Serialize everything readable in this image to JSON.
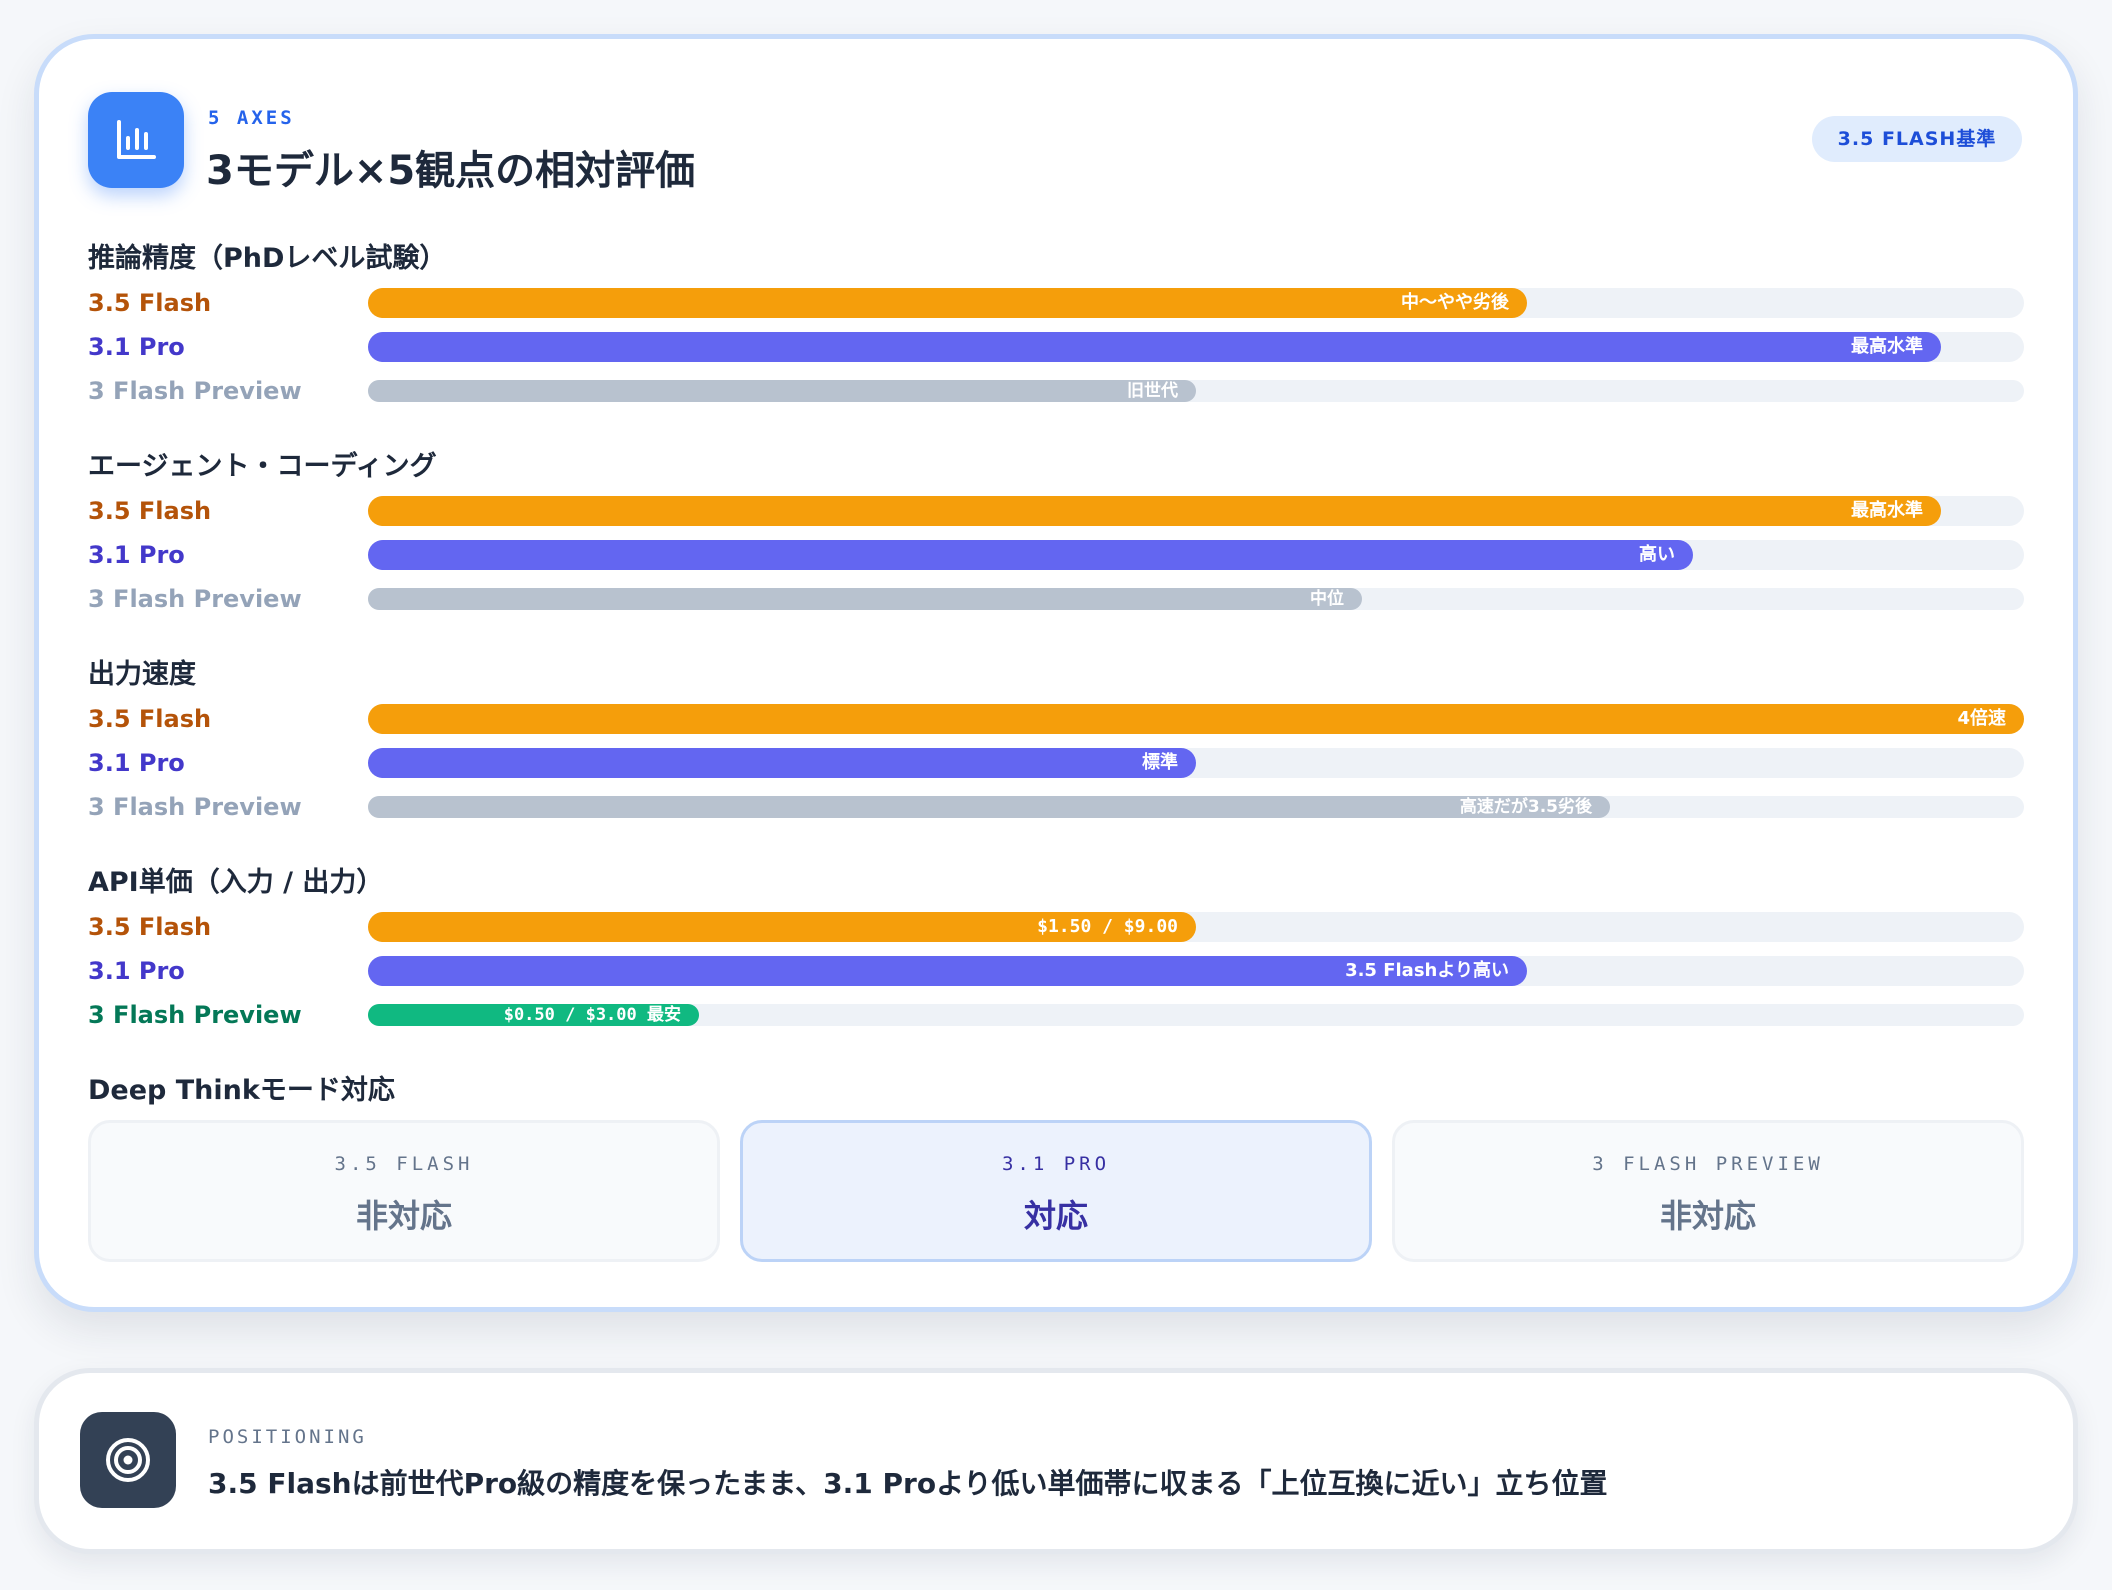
{
  "header": {
    "eyebrow": "5 AXES",
    "title": "3モデル×5観点の相対評価",
    "badge": "3.5 FLASH基準"
  },
  "colors": {
    "flash35": "#f59e0b",
    "pro31": "#6366f1",
    "preview3": "#b8c2cf",
    "cheapest": "#10b981",
    "label_flash35": "#b45309",
    "label_pro31": "#4338ca",
    "label_preview3": "#94a3b8",
    "label_cheapest": "#047857"
  },
  "chart_data": [
    {
      "type": "bar",
      "title": "推論精度（PhDレベル試験）",
      "categories": [
        "3.5 Flash",
        "3.1 Pro",
        "3 Flash Preview"
      ],
      "values": [
        70,
        95,
        50
      ],
      "value_labels": [
        "中〜やや劣後",
        "最高水準",
        "旧世代"
      ],
      "ylim": [
        0,
        100
      ]
    },
    {
      "type": "bar",
      "title": "エージェント・コーディング",
      "categories": [
        "3.5 Flash",
        "3.1 Pro",
        "3 Flash Preview"
      ],
      "values": [
        95,
        80,
        60
      ],
      "value_labels": [
        "最高水準",
        "高い",
        "中位"
      ],
      "ylim": [
        0,
        100
      ]
    },
    {
      "type": "bar",
      "title": "出力速度",
      "categories": [
        "3.5 Flash",
        "3.1 Pro",
        "3 Flash Preview"
      ],
      "values": [
        100,
        50,
        75
      ],
      "value_labels": [
        "4倍速",
        "標準",
        "高速だが3.5劣後"
      ],
      "ylim": [
        0,
        100
      ]
    },
    {
      "type": "bar",
      "title": "API単価（入力 / 出力）",
      "categories": [
        "3.5 Flash",
        "3.1 Pro",
        "3 Flash Preview"
      ],
      "values": [
        50,
        70,
        20
      ],
      "value_labels": [
        "$1.50 / $9.00",
        "3.5 Flashより高い",
        "$0.50 / $3.00 最安"
      ],
      "ylim": [
        0,
        100
      ]
    }
  ],
  "deep_think": {
    "title": "Deep Thinkモード対応",
    "items": [
      {
        "model": "3.5 FLASH",
        "status": "非対応"
      },
      {
        "model": "3.1 PRO",
        "status": "対応"
      },
      {
        "model": "3 FLASH PREVIEW",
        "status": "非対応"
      }
    ]
  },
  "positioning": {
    "eyebrow": "POSITIONING",
    "text": "3.5 Flashは前世代Pro級の精度を保ったまま、3.1 Proより低い単価帯に収まる「上位互換に近い」立ち位置"
  },
  "icons": {
    "header": "bar-chart-icon",
    "positioning": "target-icon"
  }
}
